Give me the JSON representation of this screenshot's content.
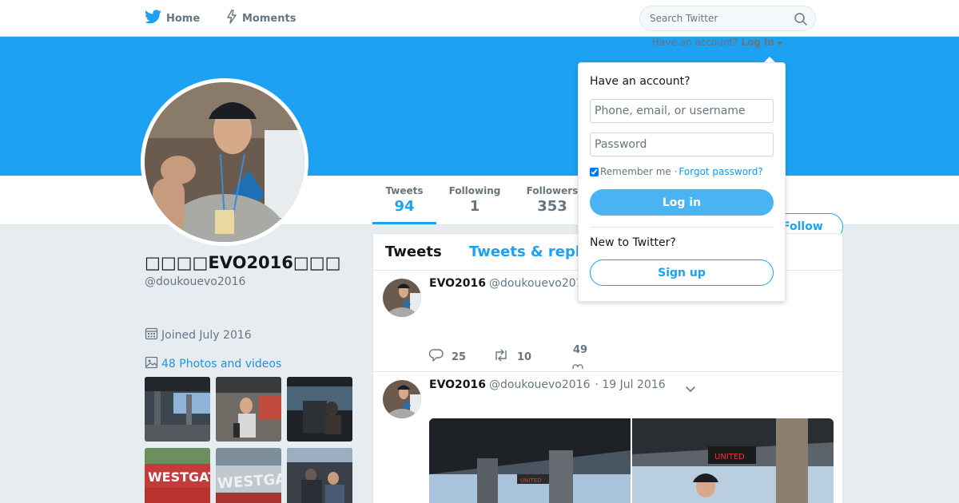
{
  "colors": {
    "brand": "#1da1f2",
    "link": "#1b95e0",
    "muted": "#657786",
    "background": "#e6ecf0"
  },
  "nav": {
    "home_label": "Home",
    "moments_label": "Moments",
    "search_placeholder": "Search Twitter",
    "icons": {
      "home": "twitter-bird-icon",
      "moments": "lightning-icon",
      "search": "search-icon"
    }
  },
  "login_hint": {
    "text": "Have an account?",
    "link": "Log in"
  },
  "profile": {
    "name": "□□□□EVO2016□□□",
    "handle": "@doukouevo2016",
    "joined": "Joined July 2016",
    "photos_link": "48 Photos and videos"
  },
  "stats": [
    {
      "label": "Tweets",
      "value": "94"
    },
    {
      "label": "Following",
      "value": "1"
    },
    {
      "label": "Followers",
      "value": "353"
    }
  ],
  "follow_label": "Follow",
  "timeline": {
    "tabs": [
      "Tweets",
      "Tweets & replies"
    ],
    "tweets": [
      {
        "name": "EVO2016",
        "handle": "@doukouevo2016",
        "date": "",
        "replies": "25",
        "retweets": "10",
        "likes": "49"
      },
      {
        "name": "EVO2016",
        "handle": "@doukouevo2016",
        "date": "· 19 Jul 2016"
      }
    ]
  },
  "login_dropdown": {
    "title": "Have an account?",
    "username_placeholder": "Phone, email, or username",
    "password_placeholder": "Password",
    "remember_label": "Remember me ·",
    "forgot_label": "Forgot password?",
    "login_button": "Log in",
    "new_label": "New to Twitter?",
    "signup_button": "Sign up"
  }
}
